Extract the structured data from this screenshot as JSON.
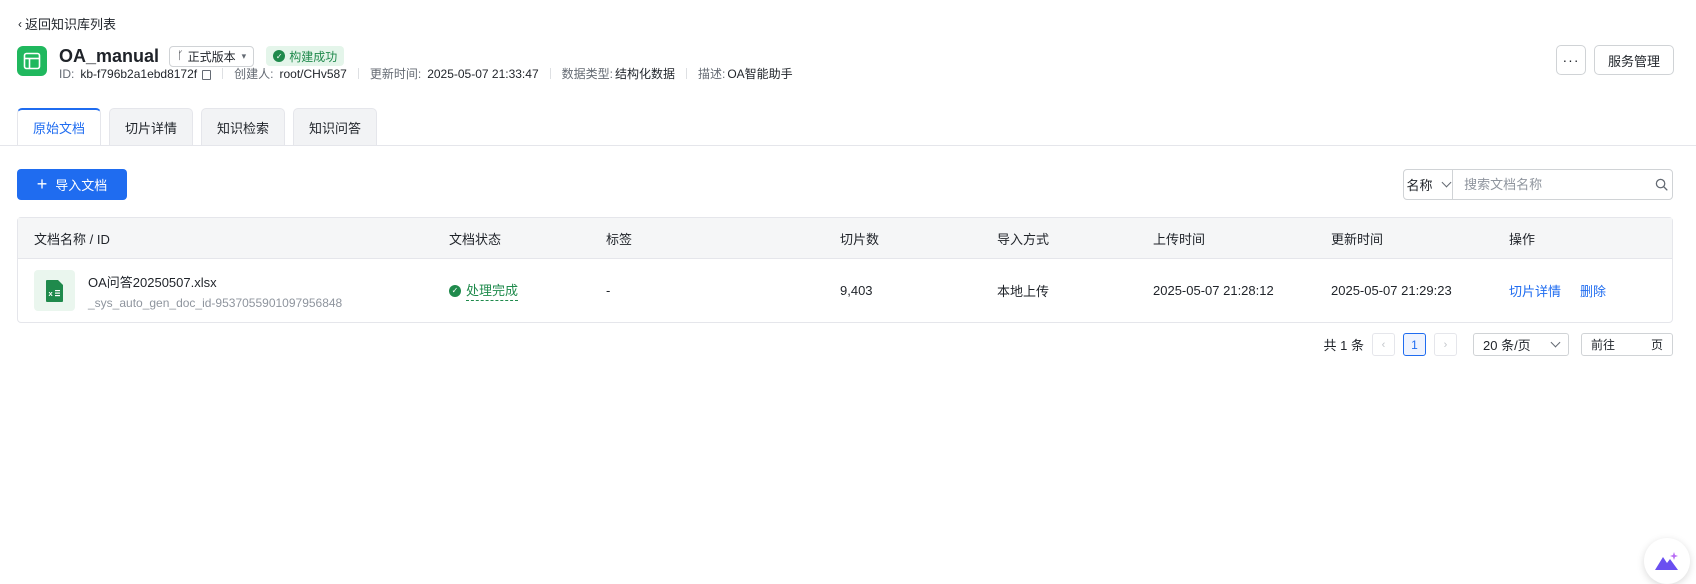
{
  "nav": {
    "back_label": "返回知识库列表"
  },
  "header": {
    "title": "OA_manual",
    "version": "正式版本",
    "status": "构建成功",
    "meta": {
      "id_label": "ID:",
      "id_value": "kb-f796b2a1ebd8172f",
      "creator_label": "创建人:",
      "creator_value": "root/CHv587",
      "updated_label": "更新时间:",
      "updated_value": "2025-05-07 21:33:47",
      "datatype_label": "数据类型:",
      "datatype_value": "结构化数据",
      "desc_label": "描述:",
      "desc_value": "OA智能助手"
    },
    "more_label": "···",
    "service_label": "服务管理"
  },
  "tabs": [
    {
      "label": "原始文档",
      "active": true
    },
    {
      "label": "切片详情",
      "active": false
    },
    {
      "label": "知识检索",
      "active": false
    },
    {
      "label": "知识问答",
      "active": false
    }
  ],
  "toolbar": {
    "import_label": "导入文档",
    "search_type": "名称",
    "search_placeholder": "搜索文档名称"
  },
  "table": {
    "columns": [
      "文档名称 / ID",
      "文档状态",
      "标签",
      "切片数",
      "导入方式",
      "上传时间",
      "更新时间",
      "操作"
    ],
    "rows": [
      {
        "name": "OA问答20250507.xlsx",
        "doc_id": "_sys_auto_gen_doc_id-9537055901097956848",
        "status": "处理完成",
        "tag": "-",
        "slices": "9,403",
        "import_method": "本地上传",
        "upload_time": "2025-05-07 21:28:12",
        "update_time": "2025-05-07 21:29:23",
        "action_detail": "切片详情",
        "action_delete": "删除"
      }
    ]
  },
  "pagination": {
    "total": "共 1 条",
    "current_page": "1",
    "page_size": "20 条/页",
    "goto_prefix": "前往",
    "goto_suffix": "页"
  },
  "colors": {
    "primary": "#1f6cf0",
    "success": "#1f8a4c",
    "kb_icon": "#20b85e"
  }
}
